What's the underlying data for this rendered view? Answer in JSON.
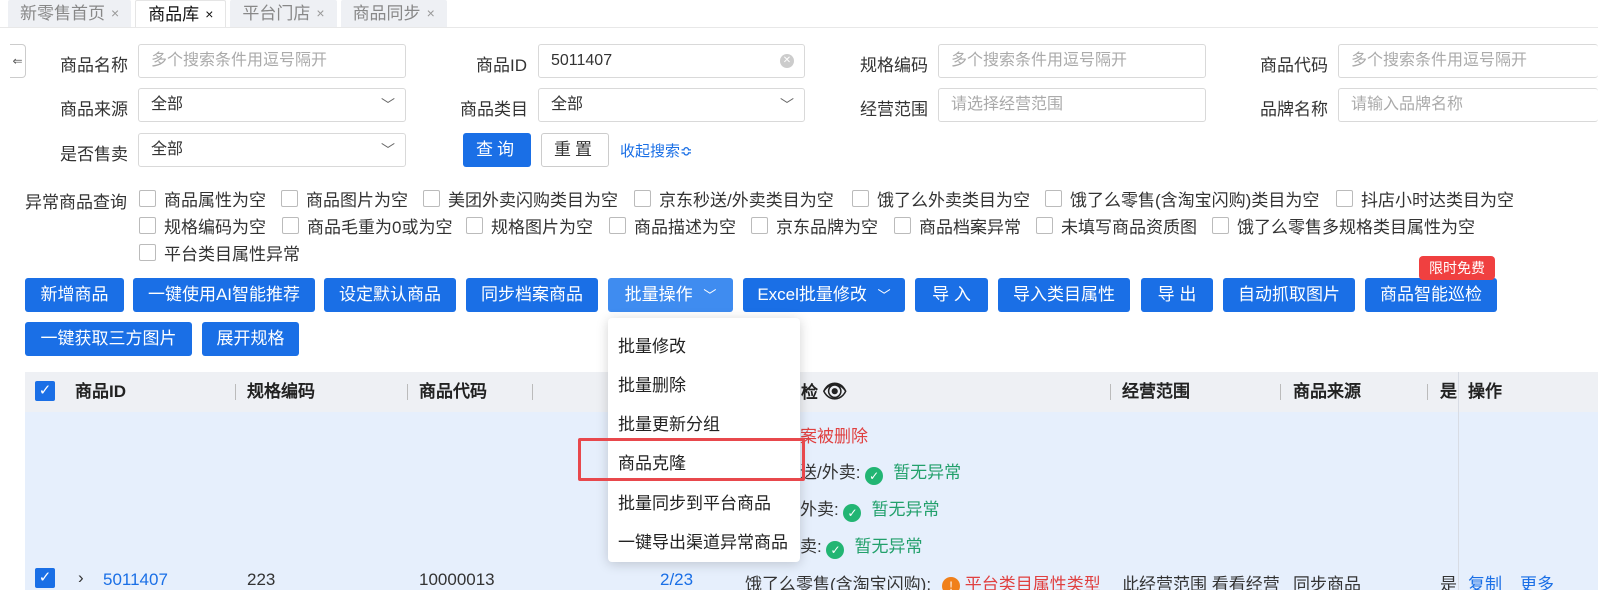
{
  "tabs": [
    {
      "label": "新零售首页",
      "active": false
    },
    {
      "label": "商品库",
      "active": true
    },
    {
      "label": "平台门店",
      "active": false
    },
    {
      "label": "商品同步",
      "active": false
    }
  ],
  "tab_close": "×",
  "collapse_icon": "⇐",
  "search": {
    "product_name": {
      "label": "商品名称",
      "placeholder": "多个搜索条件用逗号隔开"
    },
    "product_id": {
      "label": "商品ID",
      "value": "5011407"
    },
    "spec_code": {
      "label": "规格编码",
      "placeholder": "多个搜索条件用逗号隔开"
    },
    "product_code": {
      "label": "商品代码",
      "placeholder": "多个搜索条件用逗号隔开"
    },
    "product_source": {
      "label": "商品来源",
      "value": "全部"
    },
    "product_category": {
      "label": "商品类目",
      "value": "全部"
    },
    "business_scope": {
      "label": "经营范围",
      "placeholder": "请选择经营范围"
    },
    "brand_name": {
      "label": "品牌名称",
      "placeholder": "请输入品牌名称"
    },
    "on_sale": {
      "label": "是否售卖",
      "value": "全部"
    },
    "query_label": "查询",
    "reset_label": "重置",
    "collapse_label": "收起搜索≎"
  },
  "abnormal": {
    "label": "异常商品查询",
    "items": [
      "商品属性为空",
      "商品图片为空",
      "美团外卖闪购类目为空",
      "京东秒送/外卖类目为空",
      "饿了么外卖类目为空",
      "饿了么零售(含淘宝闪购)类目为空",
      "抖店小时达类目为空",
      "规格编码为空",
      "商品毛重为0或为空",
      "规格图片为空",
      "商品描述为空",
      "京东品牌为空",
      "商品档案异常",
      "未填写商品资质图",
      "饿了么零售多规格类目属性为空",
      "平台类目属性异常"
    ]
  },
  "actions": {
    "add": "新增商品",
    "ai": "一键使用AI智能推荐",
    "default": "设定默认商品",
    "sync": "同步档案商品",
    "batch": "批量操作",
    "excel": "Excel批量修改",
    "import": "导 入",
    "import_attr": "导入类目属性",
    "export": "导 出",
    "auto_img": "自动抓取图片",
    "inspect": "商品智能巡检",
    "badge": "限时免费",
    "third_img": "一键获取三方图片",
    "expand": "展开规格"
  },
  "table": {
    "headers": {
      "id": "商品ID",
      "spec": "规格编码",
      "code": "商品代码",
      "check": "检",
      "scope": "经营范围",
      "source": "商品来源",
      "sale": "是",
      "op": "操作"
    },
    "lines": {
      "deleted": "案被删除",
      "l1_prefix": "送/外卖:",
      "l2_prefix": "外卖:",
      "l3_prefix": "卖:",
      "ok": "暂无异常"
    },
    "row": {
      "id": "5011407",
      "spec": "223",
      "code": "10000013",
      "count": "2/23",
      "platform": "饿了么零售(含淘宝闪购):",
      "issue": "平台类目属性类型",
      "scope": "此经营范围 看看经营",
      "source": "同步商品",
      "sale": "是",
      "op_copy": "复制",
      "op_more": "更多"
    }
  },
  "dropdown": {
    "items": [
      "批量修改",
      "批量删除",
      "批量更新分组",
      "商品克隆",
      "批量同步到平台商品",
      "一键导出渠道异常商品"
    ],
    "highlighted": "商品克隆"
  },
  "colors": {
    "primary": "#1a6fe6",
    "highlight": "#e8484c",
    "success": "#22b573"
  }
}
